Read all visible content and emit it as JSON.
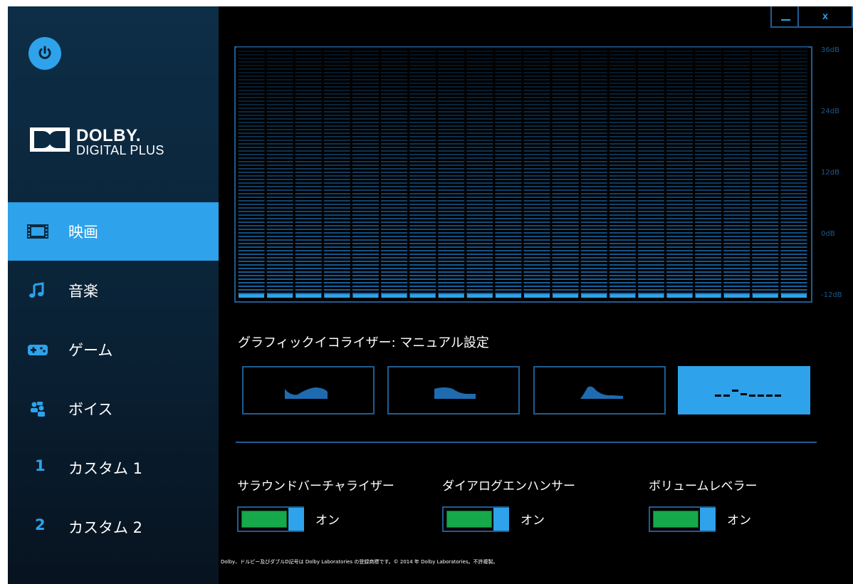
{
  "sidebar": {
    "logo": {
      "name": "DOLBY.",
      "sub": "DIGITAL PLUS"
    },
    "items": [
      {
        "label": "映画",
        "icon": "film-icon",
        "active": true
      },
      {
        "label": "音楽",
        "icon": "music-note-icon",
        "active": false
      },
      {
        "label": "ゲーム",
        "icon": "gamepad-icon",
        "active": false
      },
      {
        "label": "ボイス",
        "icon": "voice-people-icon",
        "active": false
      },
      {
        "label": "カスタム 1",
        "number": "1",
        "active": false
      },
      {
        "label": "カスタム 2",
        "number": "2",
        "active": false
      }
    ]
  },
  "window": {
    "minimize": "_",
    "close": "x"
  },
  "equalizer": {
    "db_labels": [
      "36dB",
      "24dB",
      "12dB",
      "0dB",
      "-12dB"
    ],
    "band_count": 20,
    "band_levels_db": [
      -12,
      -12,
      -12,
      -12,
      -12,
      -12,
      -12,
      -12,
      -12,
      -12,
      -12,
      -12,
      -12,
      -12,
      -12,
      -12,
      -12,
      -12,
      -12,
      -12
    ],
    "title": "グラフィックイコライザー: マニュアル設定",
    "presets": [
      {
        "icon": "eq-open-curve-icon",
        "active": false
      },
      {
        "icon": "eq-rich-curve-icon",
        "active": false
      },
      {
        "icon": "eq-focused-curve-icon",
        "active": false
      },
      {
        "icon": "eq-manual-icon",
        "active": true
      }
    ]
  },
  "toggles": [
    {
      "label": "サラウンドバーチャライザー",
      "state": "オン"
    },
    {
      "label": "ダイアログエンハンサー",
      "state": "オン"
    },
    {
      "label": "ボリュームレベラー",
      "state": "オン"
    }
  ],
  "footer": "Dolby、ドルビー及びダブルD記号は Dolby Laboratories の登録商標です。© 2014 年 Dolby Laboratories。不許複製。",
  "colors": {
    "accent": "#2ea2ea",
    "border": "#1f5c91",
    "toggle_on": "#16a84a",
    "sidebar": "#0d2e47"
  }
}
